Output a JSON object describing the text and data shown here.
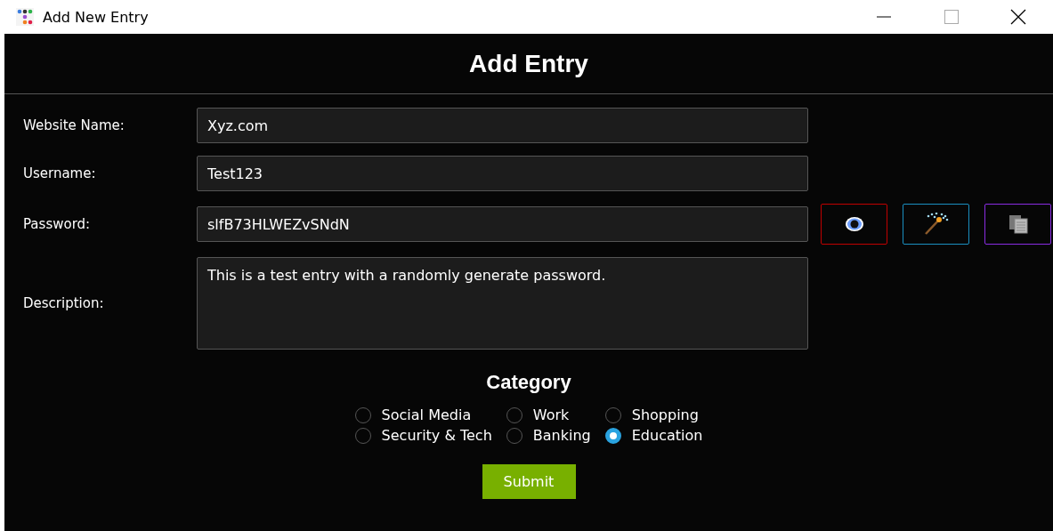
{
  "window": {
    "title": "Add New Entry"
  },
  "header": {
    "title": "Add Entry"
  },
  "fields": [
    {
      "label": "Website Name:",
      "kind": "text",
      "value": "Xyz.com"
    },
    {
      "label": "Username:",
      "kind": "text",
      "value": "Test123"
    },
    {
      "label": "Password:",
      "kind": "password",
      "value": "slfB73HLWEZvSNdN"
    },
    {
      "label": "Description:",
      "kind": "textarea",
      "value": "This is a test entry with a randomly generate password."
    }
  ],
  "password_buttons": [
    {
      "kind": "eye",
      "color": "#c00000"
    },
    {
      "kind": "wand",
      "color": "#1a8fc0"
    },
    {
      "kind": "copy",
      "color": "#8a2be2"
    }
  ],
  "category": {
    "title": "Category",
    "options": [
      {
        "label": "Social Media",
        "selected": false
      },
      {
        "label": "Work",
        "selected": false
      },
      {
        "label": "Shopping",
        "selected": false
      },
      {
        "label": "Security & Tech",
        "selected": false
      },
      {
        "label": "Banking",
        "selected": false
      },
      {
        "label": "Education",
        "selected": true
      }
    ]
  },
  "submit": {
    "label": "Submit"
  }
}
